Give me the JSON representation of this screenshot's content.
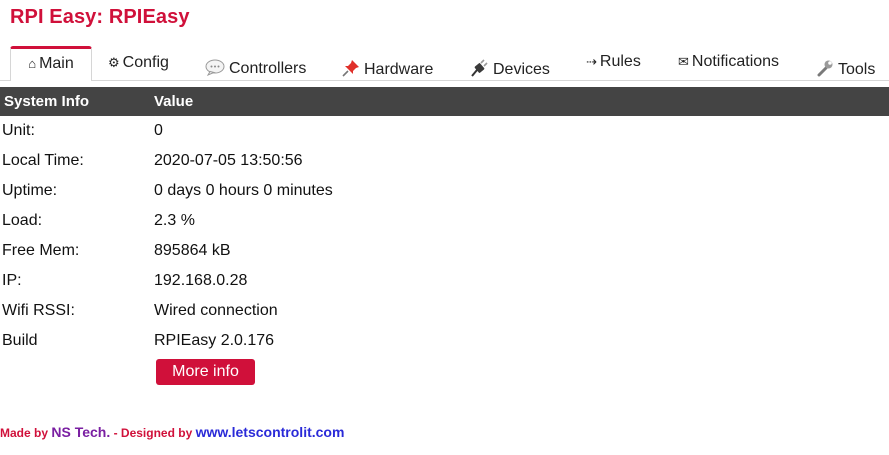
{
  "app": {
    "title": "RPI Easy: RPIEasy"
  },
  "tabs": {
    "main": {
      "label": "Main",
      "icon": "home-icon",
      "glyph": "⌂"
    },
    "config": {
      "label": "Config",
      "icon": "gear-icon",
      "glyph": "⚙"
    },
    "controllers": {
      "label": "Controllers",
      "icon": "speech-bubble-icon"
    },
    "hardware": {
      "label": "Hardware",
      "icon": "pushpin-icon"
    },
    "devices": {
      "label": "Devices",
      "icon": "plug-icon"
    },
    "rules": {
      "label": "Rules",
      "icon": "arrow-right-icon",
      "glyph": "⇢"
    },
    "notifications": {
      "label": "Notifications",
      "icon": "envelope-icon",
      "glyph": "✉"
    },
    "tools": {
      "label": "Tools",
      "icon": "wrench-icon"
    }
  },
  "table": {
    "headers": {
      "name": "System Info",
      "value": "Value"
    },
    "rows": [
      {
        "label": "Unit:",
        "value": "0"
      },
      {
        "label": "Local Time:",
        "value": "2020-07-05 13:50:56"
      },
      {
        "label": "Uptime:",
        "value": "0 days 0 hours 0 minutes"
      },
      {
        "label": "Load:",
        "value": "2.3 %"
      },
      {
        "label": "Free Mem:",
        "value": "895864 kB"
      },
      {
        "label": "IP:",
        "value": "192.168.0.28"
      },
      {
        "label": "Wifi RSSI:",
        "value": "Wired connection"
      },
      {
        "label": "Build",
        "value": "RPIEasy 2.0.176"
      }
    ]
  },
  "more_info_label": "More info",
  "footer": {
    "made_by": "Made by ",
    "brand": "NS Tech.",
    "designed_by": " - Designed by ",
    "link": "www.letscontrolit.com"
  },
  "colors": {
    "accent": "#d0103a",
    "header_bg": "#444444",
    "brand": "#7a1fa2",
    "link": "#2a2ad8"
  }
}
